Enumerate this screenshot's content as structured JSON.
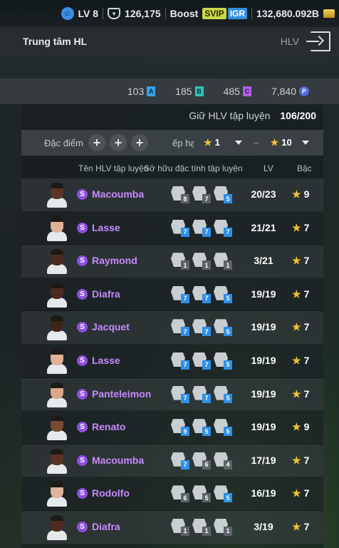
{
  "topbar": {
    "level": "LV 8",
    "points": "126,175",
    "boost_label": "Boost",
    "svip": "SVIP",
    "igr": "IGR",
    "balance": "132,680.092B"
  },
  "header": {
    "title": "Trung tâm HL",
    "hlv_label": "HLV"
  },
  "resources": [
    {
      "value": "103",
      "tag": "A"
    },
    {
      "value": "185",
      "tag": "B"
    },
    {
      "value": "485",
      "tag": "C"
    },
    {
      "value": "7,840",
      "tag": "P"
    }
  ],
  "retain": {
    "label": "Giữ HLV tập luyện",
    "value": "106/200"
  },
  "filter": {
    "trait_label": "Đặc điểm c",
    "rank_label": "ếp hạng",
    "rank_min": "1",
    "rank_max": "10",
    "tilde": "~"
  },
  "columns": {
    "name": "Tên HLV tập luyện",
    "traits": "Sở hữu đặc tính tập luyện",
    "lv": "LV",
    "grade": "Bậc"
  },
  "trainers": [
    {
      "name": "Macoumba",
      "skin": "#5a3524",
      "traits": [
        {
          "lvl": "8",
          "c": "gray"
        },
        {
          "lvl": "7",
          "c": "gray"
        },
        {
          "lvl": "5",
          "c": "blue"
        }
      ],
      "lv": "20/23",
      "grade": "9"
    },
    {
      "name": "Lasse",
      "skin": "#e1b195",
      "traits": [
        {
          "lvl": "7",
          "c": "blue"
        },
        {
          "lvl": "7",
          "c": "blue"
        },
        {
          "lvl": "7",
          "c": "blue"
        }
      ],
      "lv": "21/21",
      "grade": "7"
    },
    {
      "name": "Raymond",
      "skin": "#4a2c1e",
      "traits": [
        {
          "lvl": "1",
          "c": "gray"
        },
        {
          "lvl": "1",
          "c": "gray"
        },
        {
          "lvl": "1",
          "c": "gray"
        }
      ],
      "lv": "3/21",
      "grade": "7"
    },
    {
      "name": "Diafra",
      "skin": "#4b2c1f",
      "traits": [
        {
          "lvl": "7",
          "c": "blue"
        },
        {
          "lvl": "7",
          "c": "blue"
        },
        {
          "lvl": "5",
          "c": "blue"
        }
      ],
      "lv": "19/19",
      "grade": "7"
    },
    {
      "name": "Jacquet",
      "skin": "#3e2519",
      "traits": [
        {
          "lvl": "7",
          "c": "blue"
        },
        {
          "lvl": "7",
          "c": "blue"
        },
        {
          "lvl": "5",
          "c": "blue"
        }
      ],
      "lv": "19/19",
      "grade": "7"
    },
    {
      "name": "Lasse",
      "skin": "#e1b195",
      "traits": [
        {
          "lvl": "7",
          "c": "blue"
        },
        {
          "lvl": "7",
          "c": "blue"
        },
        {
          "lvl": "5",
          "c": "blue"
        }
      ],
      "lv": "19/19",
      "grade": "7"
    },
    {
      "name": "Panteleimon",
      "skin": "#d9a88a",
      "traits": [
        {
          "lvl": "7",
          "c": "blue"
        },
        {
          "lvl": "7",
          "c": "blue"
        },
        {
          "lvl": "5",
          "c": "blue"
        }
      ],
      "lv": "19/19",
      "grade": "7"
    },
    {
      "name": "Renato",
      "skin": "#7a4a33",
      "traits": [
        {
          "lvl": "9",
          "c": "blue"
        },
        {
          "lvl": "5",
          "c": "blue"
        },
        {
          "lvl": "5",
          "c": "blue"
        }
      ],
      "lv": "19/19",
      "grade": "9"
    },
    {
      "name": "Macoumba",
      "skin": "#5a3524",
      "traits": [
        {
          "lvl": "7",
          "c": "blue"
        },
        {
          "lvl": "6",
          "c": "gray"
        },
        {
          "lvl": "4",
          "c": "gray"
        }
      ],
      "lv": "17/19",
      "grade": "7"
    },
    {
      "name": "Rodolfo",
      "skin": "#e0b49a",
      "traits": [
        {
          "lvl": "6",
          "c": "gray"
        },
        {
          "lvl": "5",
          "c": "gray"
        },
        {
          "lvl": "5",
          "c": "blue"
        }
      ],
      "lv": "16/19",
      "grade": "7"
    },
    {
      "name": "Diafra",
      "skin": "#4b2c1f",
      "traits": [
        {
          "lvl": "1",
          "c": "gray"
        },
        {
          "lvl": "1",
          "c": "gray"
        },
        {
          "lvl": "1",
          "c": "gray"
        }
      ],
      "lv": "3/19",
      "grade": "7"
    }
  ],
  "colors": {
    "accent_purple": "#c58bff",
    "star": "#f2c233",
    "trait_blue": "#2f8fe8"
  }
}
